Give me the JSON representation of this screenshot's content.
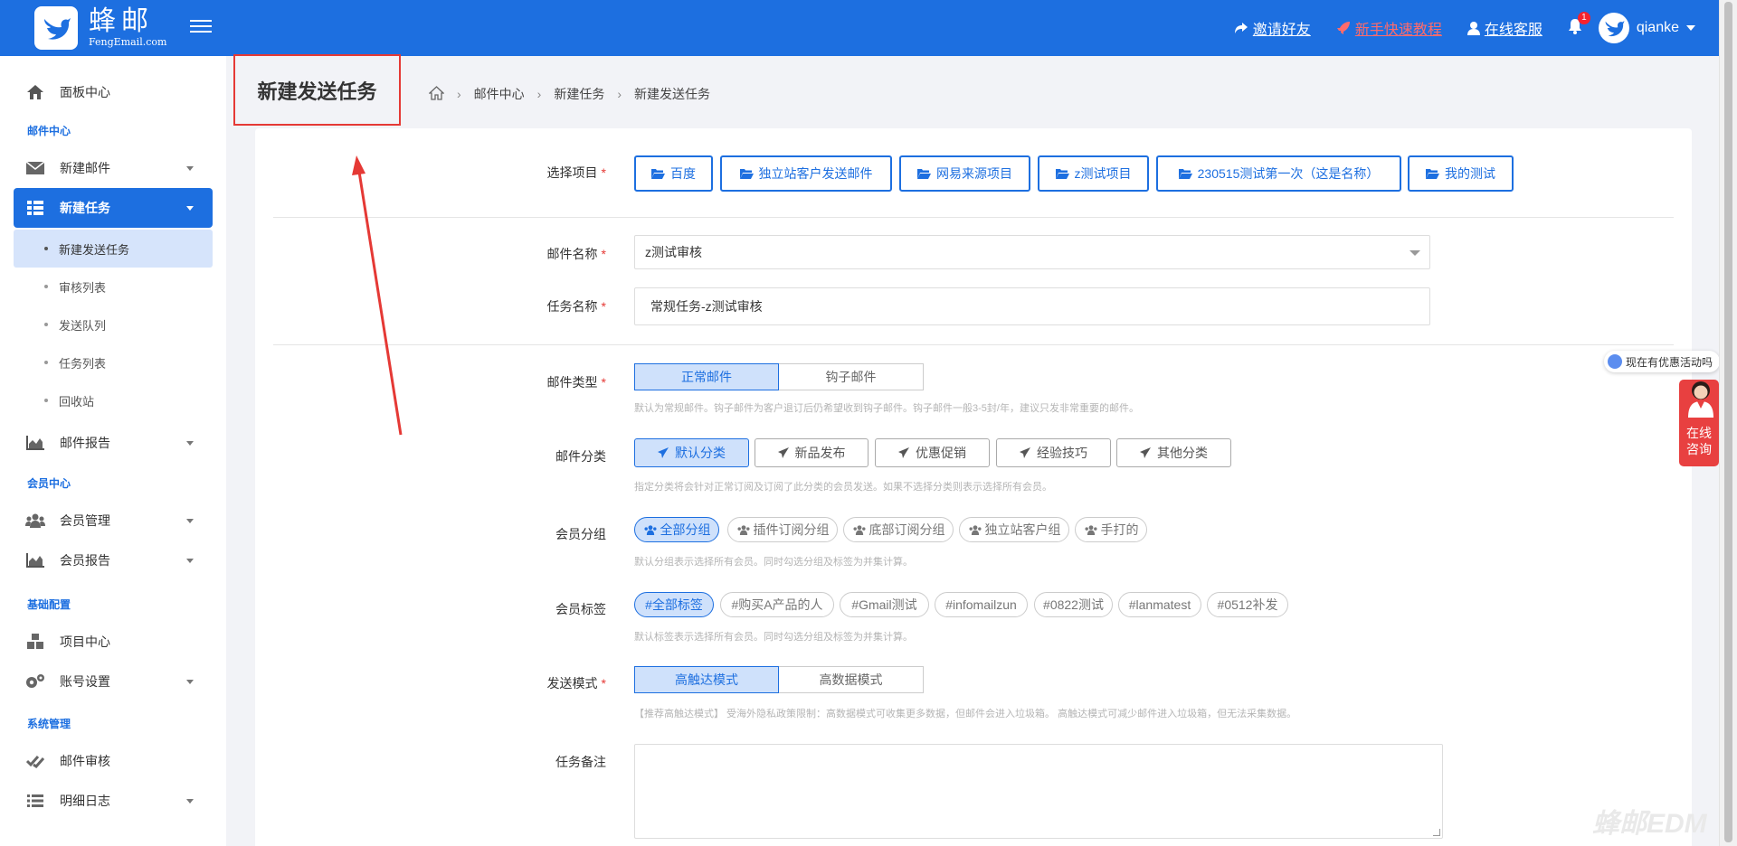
{
  "header": {
    "logo_cn": "蜂邮",
    "logo_en": "FengEmail.com",
    "links": {
      "invite": "邀请好友",
      "tutorial": "新手快速教程",
      "support": "在线客服"
    },
    "notification_count": "1",
    "username": "qianke",
    "colors": {
      "brand": "#1d6fe0",
      "tutorial": "#ff6b6b"
    }
  },
  "sidebar": {
    "dashboard": "面板中心",
    "sections": {
      "mail_center": "邮件中心",
      "member_center": "会员中心",
      "basic_config": "基础配置",
      "system_admin": "系统管理"
    },
    "items": {
      "new_email": "新建邮件",
      "new_task": "新建任务",
      "sub_new_send_task": "新建发送任务",
      "sub_review_list": "审核列表",
      "sub_send_queue": "发送队列",
      "sub_task_list": "任务列表",
      "sub_recycle_bin": "回收站",
      "mail_report": "邮件报告",
      "member_manage": "会员管理",
      "member_report": "会员报告",
      "project_center": "项目中心",
      "account_settings": "账号设置",
      "mail_review": "邮件审核",
      "detail_log": "明细日志"
    }
  },
  "page": {
    "title": "新建发送任务",
    "breadcrumb": [
      "邮件中心",
      "新建任务",
      "新建发送任务"
    ]
  },
  "form": {
    "project": {
      "label": "选择项目",
      "options": [
        "百度",
        "独立站客户发送邮件",
        "网易来源项目",
        "z测试项目",
        "230515测试第一次（这是名称）",
        "我的测试"
      ]
    },
    "mail_name": {
      "label": "邮件名称",
      "value": "z测试审核"
    },
    "task_name": {
      "label": "任务名称",
      "value": "常规任务-z测试审核"
    },
    "mail_type": {
      "label": "邮件类型",
      "options": [
        "正常邮件",
        "钩子邮件"
      ],
      "selected": "正常邮件",
      "hint": "默认为常规邮件。钩子邮件为客户退订后仍希望收到钩子邮件。钩子邮件一般3-5封/年，建议只发非常重要的邮件。"
    },
    "mail_category": {
      "label": "邮件分类",
      "options": [
        "默认分类",
        "新品发布",
        "优惠促销",
        "经验技巧",
        "其他分类"
      ],
      "selected": "默认分类",
      "hint": "指定分类将会针对正常订阅及订阅了此分类的会员发送。如果不选择分类则表示选择所有会员。"
    },
    "member_group": {
      "label": "会员分组",
      "options": [
        "全部分组",
        "插件订阅分组",
        "底部订阅分组",
        "独立站客户组",
        "手打的"
      ],
      "selected": "全部分组",
      "hint": "默认分组表示选择所有会员。同时勾选分组及标签为并集计算。"
    },
    "member_tag": {
      "label": "会员标签",
      "options": [
        "#全部标签",
        "#购买A产品的人",
        "#Gmail测试",
        "#infomailzun",
        "#0822测试",
        "#lanmatest",
        "#0512补发"
      ],
      "selected": "#全部标签",
      "hint": "默认标签表示选择所有会员。同时勾选分组及标签为并集计算。"
    },
    "send_mode": {
      "label": "发送模式",
      "options": [
        "高触达模式",
        "高数据模式"
      ],
      "selected": "高触达模式",
      "hint": "【推荐高触达模式】 受海外隐私政策限制：高数据模式可收集更多数据，但邮件会进入垃圾箱。 高触达模式可减少邮件进入垃圾箱，但无法采集数据。"
    },
    "task_note": {
      "label": "任务备注",
      "value": ""
    }
  },
  "floating": {
    "promo": "现在有优惠活动吗",
    "consult_line1": "在线",
    "consult_line2": "咨询",
    "watermark": "蜂邮EDM"
  }
}
